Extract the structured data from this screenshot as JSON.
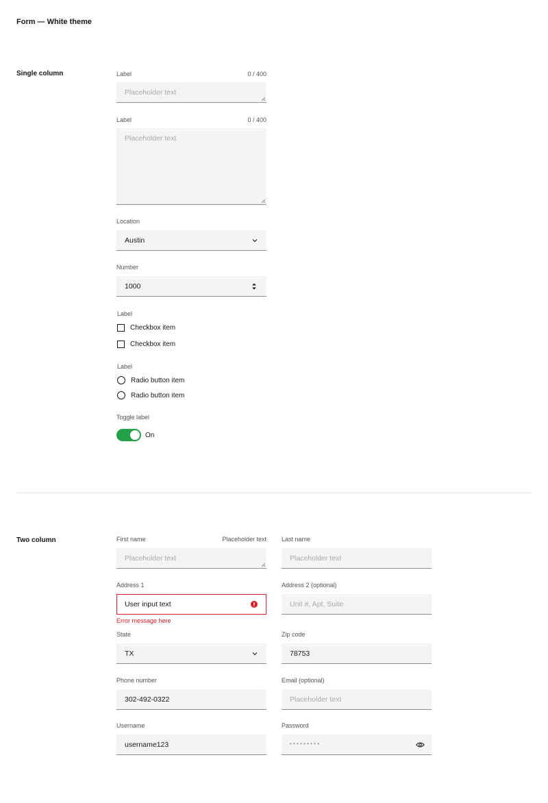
{
  "page_title": "Form — White theme",
  "single_column": {
    "section_title": "Single column",
    "text_input": {
      "label": "Label",
      "counter": "0 / 400",
      "placeholder": "Placeholder text"
    },
    "text_area": {
      "label": "Label",
      "counter": "0 / 400",
      "placeholder": "Placeholder text"
    },
    "location": {
      "label": "Location",
      "value": "Austin"
    },
    "number": {
      "label": "Number",
      "value": "1000"
    },
    "checkbox_group": {
      "label": "Label",
      "items": [
        "Checkbox item",
        "Checkbox item"
      ]
    },
    "radio_group": {
      "label": "Label",
      "items": [
        "Radio button item",
        "Radio button item"
      ]
    },
    "toggle": {
      "label": "Toggle label",
      "state_text": "On",
      "on": true,
      "color": "#24a148"
    }
  },
  "two_column": {
    "section_title": "Two column",
    "first_name": {
      "label": "First name",
      "helper": "Placeholder text",
      "placeholder": "Placeholder text"
    },
    "last_name": {
      "label": "Last name",
      "placeholder": "Placeholder text"
    },
    "address1": {
      "label": "Address 1",
      "value": "User input text",
      "error": "Error message here"
    },
    "address2": {
      "label": "Address 2 (optional)",
      "placeholder": "Unit #, Apt, Suite"
    },
    "state": {
      "label": "State",
      "value": "TX"
    },
    "zip": {
      "label": "Zip code",
      "value": "78753"
    },
    "phone": {
      "label": "Phone number",
      "value": "302-492-0322"
    },
    "email": {
      "label": "Email (optional)",
      "placeholder": "Placeholder text"
    },
    "username": {
      "label": "Username",
      "value": "username123"
    },
    "password": {
      "label": "Password",
      "masked": "• • • • • • • • •"
    }
  },
  "colors": {
    "error": "#da1e28",
    "field_bg": "#f4f4f4",
    "toggle_on": "#24a148"
  }
}
